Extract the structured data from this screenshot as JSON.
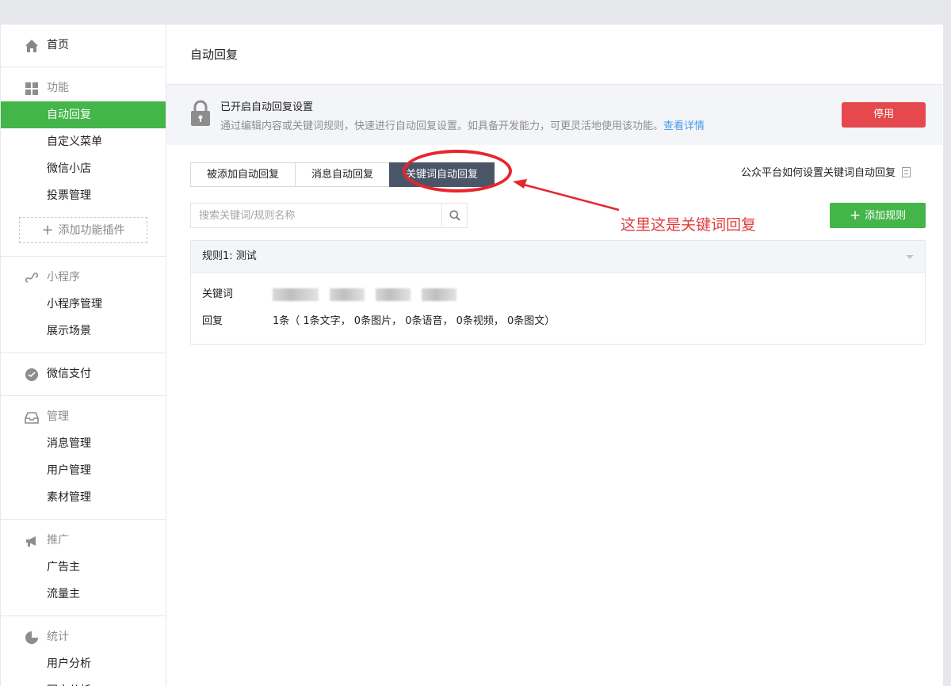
{
  "sidebar": {
    "home": "首页",
    "groups": [
      {
        "title": "功能",
        "items": [
          "自动回复",
          "自定义菜单",
          "微信小店",
          "投票管理"
        ]
      },
      {
        "title": "小程序",
        "items": [
          "小程序管理",
          "展示场景"
        ]
      },
      {
        "title": "微信支付",
        "items": []
      },
      {
        "title": "管理",
        "items": [
          "消息管理",
          "用户管理",
          "素材管理"
        ]
      },
      {
        "title": "推广",
        "items": [
          "广告主",
          "流量主"
        ]
      },
      {
        "title": "统计",
        "items": [
          "用户分析",
          "图文分析"
        ]
      }
    ],
    "add_plugin": "添加功能插件"
  },
  "main": {
    "page_title": "自动回复",
    "status": {
      "title": "已开启自动回复设置",
      "desc": "通过编辑内容或关键词规则，快速进行自动回复设置。如具备开发能力，可更灵活地使用该功能。",
      "link": "查看详情",
      "disable_btn": "停用"
    },
    "tabs": [
      "被添加自动回复",
      "消息自动回复",
      "关键词自动回复"
    ],
    "help_link": "公众平台如何设置关键词自动回复",
    "search_placeholder": "搜索关键词/规则名称",
    "add_rule": "添加规则",
    "rule": {
      "title": "规则1: 测试",
      "keyword_label": "关键词",
      "reply_label": "回复",
      "reply_value": "1条（ 1条文字， 0条图片， 0条语音， 0条视频， 0条图文）"
    }
  },
  "annotation": {
    "text": "这里这是关键词回复",
    "color": "#e8252c"
  },
  "colors": {
    "accent_green": "#44b549",
    "danger_red": "#e5484d",
    "tab_active": "#4b5568",
    "link_blue": "#459ae9"
  }
}
